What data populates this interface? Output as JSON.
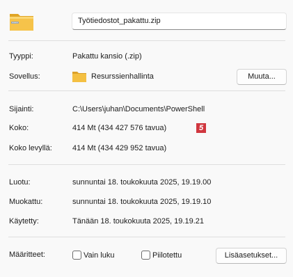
{
  "file": {
    "name": "Työtiedostot_pakattu.zip",
    "icon": "zip-folder-icon"
  },
  "general": {
    "type_label": "Tyyppi:",
    "type_value": "Pakattu kansio (.zip)",
    "app_label": "Sovellus:",
    "app_icon": "folder-icon",
    "app_value": "Resurssienhallinta",
    "change_button": "Muuta..."
  },
  "location": {
    "location_label": "Sijainti:",
    "location_value": "C:\\Users\\juhan\\Documents\\PowerShell",
    "size_label": "Koko:",
    "size_value": "414 Mt (434 427 576 tavua)",
    "size_badge": "5",
    "disk_label": "Koko levyllä:",
    "disk_value": "414 Mt (434 429 952 tavua)"
  },
  "dates": {
    "created_label": "Luotu:",
    "created_value": "sunnuntai 18. toukokuuta 2025, 19.19.00",
    "modified_label": "Muokattu:",
    "modified_value": "sunnuntai 18. toukokuuta 2025, 19.19.10",
    "accessed_label": "Käytetty:",
    "accessed_value": "Tänään 18. toukokuuta 2025, 19.19.21"
  },
  "attributes": {
    "label": "Määritteet:",
    "readonly_label": "Vain luku",
    "readonly_checked": false,
    "hidden_label": "Piilotettu",
    "hidden_checked": false,
    "advanced_button": "Lisäasetukset..."
  },
  "colors": {
    "badge": "#d0373f",
    "folder": "#f4c042",
    "separator": "#dedede"
  }
}
